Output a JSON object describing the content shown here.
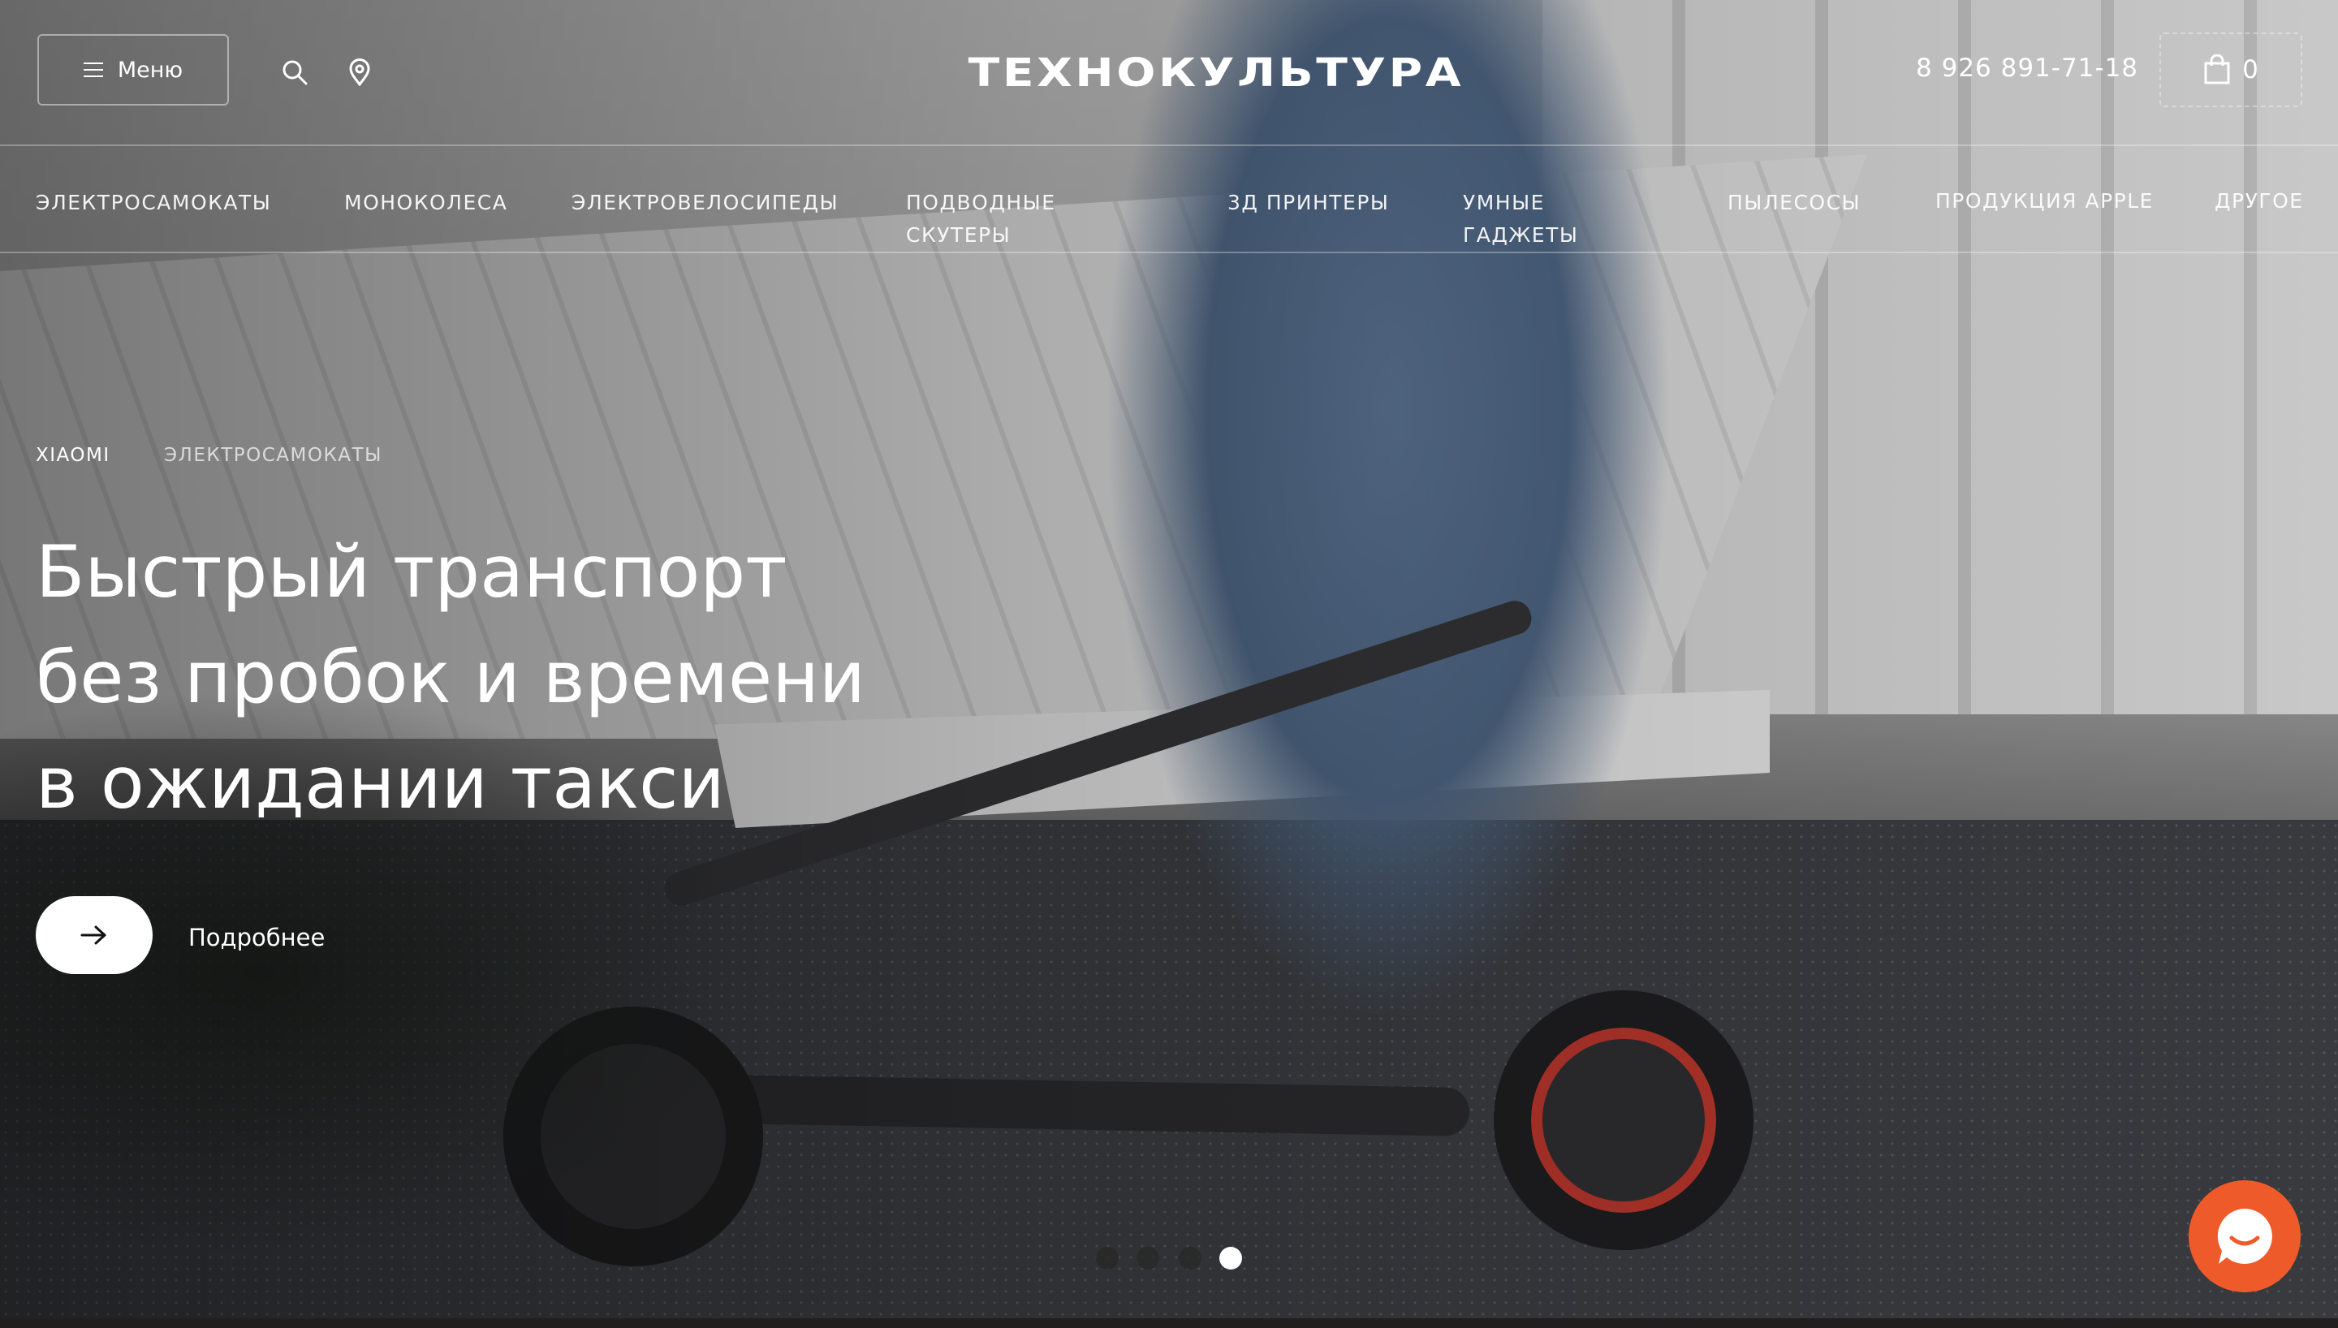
{
  "header": {
    "menu_label": "Меню",
    "logo_text": "ТЕХНОКУЛЬТУРА",
    "phone": "8 926 891-71-18",
    "cart_count": "0",
    "icons": [
      "menu-icon",
      "search-icon",
      "location-pin-icon",
      "shopping-bag-icon"
    ]
  },
  "nav": {
    "items": [
      {
        "label": "ЭЛЕКТРОСАМОКАТЫ"
      },
      {
        "label": "МОНОКОЛЕСА"
      },
      {
        "label": "ЭЛЕКТРОВЕЛОСИПЕДЫ"
      },
      {
        "label": "ПОДВОДНЫЕ СКУТЕРЫ"
      },
      {
        "label": "3Д ПРИНТЕРЫ"
      },
      {
        "label": "УМНЫЕ ГАДЖЕТЫ"
      },
      {
        "label": "ПЫЛЕСОСЫ"
      },
      {
        "label": "ПРОДУКЦИЯ APPLE"
      },
      {
        "label": "ДРУГОЕ"
      }
    ]
  },
  "hero": {
    "tags": [
      "XIAOMI",
      "ЭЛЕКТРОСАМОКАТЫ"
    ],
    "headline_lines": [
      "Быстрый транспорт",
      "без пробок и времени",
      "в ожидании такси"
    ],
    "cta_label": "Подробнее",
    "slides_total": 4,
    "active_slide": 4
  },
  "chat": {
    "icon": "chat-smile-icon",
    "color": "#ef5a2a"
  }
}
